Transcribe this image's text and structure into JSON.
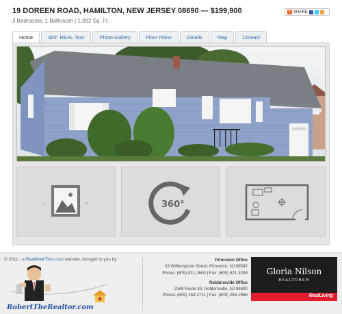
{
  "listing": {
    "title": "19 DOREEN ROAD, HAMILTON, NEW JERSEY 08690  —  $199,900",
    "subtitle": "3 Bedrooms, 1 Bathroom  |   1,092 Sq. Ft."
  },
  "share": {
    "label": "SHARE"
  },
  "tabs": [
    {
      "label": "Home",
      "active": true
    },
    {
      "label": "360° REAL Tour"
    },
    {
      "label": "Photo Gallery"
    },
    {
      "label": "Floor Plans"
    },
    {
      "label": "Details"
    },
    {
      "label": "Map"
    },
    {
      "label": "Contact"
    }
  ],
  "thumbnails": [
    {
      "icon": "photo-gallery-icon"
    },
    {
      "icon": "360-tour-icon",
      "text": "360°"
    },
    {
      "icon": "floor-plan-icon"
    }
  ],
  "footer": {
    "copyright_prefix": "© 2011 - a ",
    "copyright_link": "RealWalkThru.com",
    "copyright_suffix": " website, brought to you by:",
    "agent_name": "RobertTheRealtor.com",
    "offices": [
      {
        "name": "Princeton Office",
        "address": "33 Witherspoon Street, Princeton, NJ 08542",
        "phone": "Phone: (609) 921-2600  |  Fax: (609) 921-3299"
      },
      {
        "name": "Robbinsville Office",
        "address": "2348 Route 33, Robbinsville, NJ 08690",
        "phone": "Phone: (609) 259-2711  |  Fax: (609) 259-2866"
      }
    ],
    "brand": {
      "name": "Gloria Nilson",
      "sub": "REALTORS®",
      "tag": "RealLiving"
    }
  },
  "colors": {
    "link": "#2a6aa8",
    "house_siding": "#8fa3c9",
    "brand_red": "#e21b2d"
  }
}
